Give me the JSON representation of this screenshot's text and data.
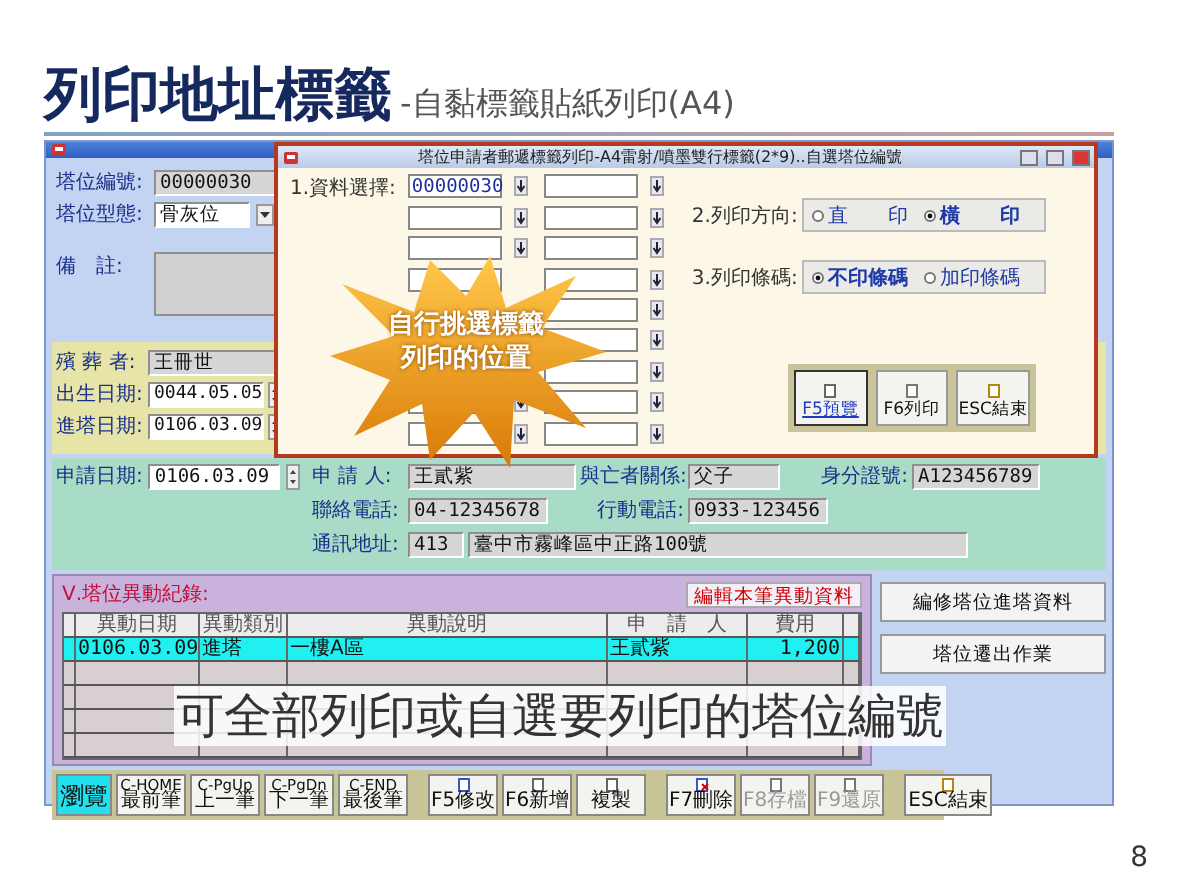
{
  "slide": {
    "title": "列印地址標籤",
    "subtitle": "-自黏標籤貼紙列印(A4)",
    "page_number": "8"
  },
  "main_window": {
    "top_fields": [
      {
        "label": "塔位編號:",
        "value": "00000030",
        "kind": "text"
      },
      {
        "label": "塔位型態:",
        "value": "骨灰位",
        "kind": "dropdown"
      }
    ],
    "remarks_label": "備　註:",
    "deceased": [
      {
        "label": "殯 葬 者:",
        "value": "王冊世",
        "kind": "text"
      },
      {
        "label": "出生日期:",
        "value": "0044.05.05",
        "kind": "spinner"
      },
      {
        "label": "進塔日期:",
        "value": "0106.03.09",
        "kind": "spinner"
      }
    ],
    "application_date": {
      "label": "申請日期:",
      "value": "0106.03.09"
    },
    "applicant_rows": [
      [
        {
          "label": "申 請 人:",
          "value": "王貳紫"
        },
        {
          "label": "與亡者關係:",
          "value": "父子"
        },
        {
          "label": "身分證號:",
          "value": "A123456789"
        }
      ],
      [
        {
          "label": "聯絡電話:",
          "value": "04-12345678"
        },
        {
          "label": "行動電話:",
          "value": "0933-123456"
        }
      ],
      [
        {
          "label": "通訊地址:",
          "value": "413"
        },
        {
          "value": "臺中市霧峰區中正路100號"
        }
      ]
    ],
    "history": {
      "title": "Ⅴ.塔位異動紀錄:",
      "edit_button": "編輯本筆異動資料",
      "columns": [
        "異動日期",
        "異動類別",
        "異動說明",
        "申　請　人",
        "費用"
      ],
      "rows": [
        {
          "cells": [
            "0106.03.09",
            "進塔",
            "一樓A區",
            "王貳紫",
            "1,200"
          ],
          "selected": true
        }
      ]
    },
    "side_buttons": [
      "編修塔位進塔資料",
      "塔位遷出作業"
    ],
    "toolbar": [
      {
        "kind": "mode",
        "label": "瀏覽",
        "selected": true
      },
      {
        "kind": "nav",
        "hotkey": "C-HOME",
        "label": "最前筆"
      },
      {
        "kind": "nav",
        "hotkey": "C-PgUp",
        "label": "上一筆"
      },
      {
        "kind": "nav",
        "hotkey": "C-PgDn",
        "label": "下一筆"
      },
      {
        "kind": "nav",
        "hotkey": "C-END",
        "label": "最後筆"
      },
      {
        "kind": "action",
        "label": "F5修改",
        "disabled": false
      },
      {
        "kind": "action",
        "label": "F6新增",
        "disabled": false
      },
      {
        "kind": "action",
        "label": "複製",
        "disabled": false
      },
      {
        "kind": "action",
        "label": "F7刪除",
        "disabled": false
      },
      {
        "kind": "action",
        "label": "F8存檔",
        "disabled": true
      },
      {
        "kind": "action",
        "label": "F9還原",
        "disabled": true
      },
      {
        "kind": "action",
        "label": "ESC結束",
        "disabled": false
      }
    ]
  },
  "dialog": {
    "title": "塔位申請者郵遞標籤列印-A4雷射/噴墨雙行標籤(2*9)..自選塔位編號",
    "selection_label": "1.資料選擇:",
    "slot_values": [
      "00000030"
    ],
    "orientation": {
      "label": "2.列印方向:",
      "options": [
        {
          "label": "直　　印",
          "selected": false
        },
        {
          "label": "橫　　印",
          "selected": true
        }
      ]
    },
    "barcode": {
      "label": "3.列印條碼:",
      "options": [
        {
          "label": "不印條碼",
          "selected": true
        },
        {
          "label": "加印條碼",
          "selected": false
        }
      ]
    },
    "buttons": [
      {
        "label": "F5預覽",
        "focused": true
      },
      {
        "label": "F6列印",
        "focused": false
      },
      {
        "label": "ESC結束",
        "focused": false
      }
    ]
  },
  "callout_lines": [
    "自行挑選標籤",
    "列印的位置"
  ],
  "caption": "可全部列印或自選要列印的塔位編號"
}
